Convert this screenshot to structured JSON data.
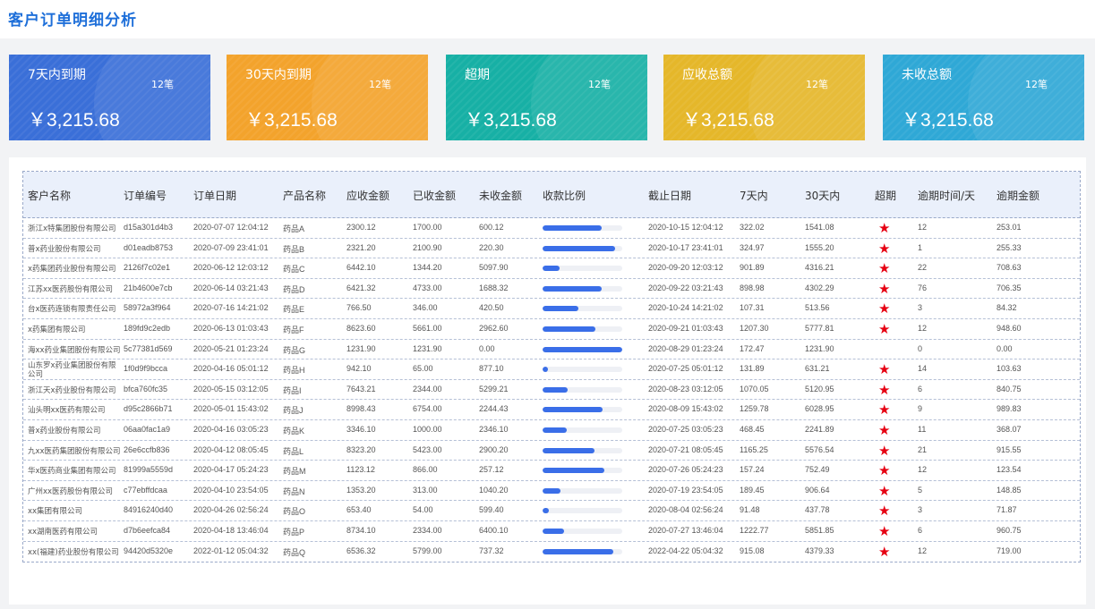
{
  "page_title": "客户订单明细分析",
  "cards": [
    {
      "title": "7天内到期",
      "count": "12笔",
      "amount": "￥3,215.68",
      "color": "#3a6fd8"
    },
    {
      "title": "30天内到期",
      "count": "12笔",
      "amount": "￥3,215.68",
      "color": "#f3a32c"
    },
    {
      "title": "超期",
      "count": "12笔",
      "amount": "￥3,215.68",
      "color": "#17b0a5"
    },
    {
      "title": "应收总额",
      "count": "12笔",
      "amount": "￥3,215.68",
      "color": "#e5b72a"
    },
    {
      "title": "未收总额",
      "count": "12笔",
      "amount": "￥3,215.68",
      "color": "#2fa8d6"
    }
  ],
  "table": {
    "headers": [
      "客户名称",
      "订单编号",
      "订单日期",
      "产品名称",
      "应收金额",
      "已收金额",
      "未收金额",
      "收款比例",
      "截止日期",
      "7天内",
      "30天内",
      "超期",
      "逾期时间/天",
      "逾期金额"
    ],
    "rows": [
      {
        "customer": "浙江x特集团股份有限公司",
        "order_no": "d15a301d4b3",
        "order_date": "2020-07-07 12:04:12",
        "product": "药品A",
        "receivable": "2300.12",
        "received": "1700.00",
        "unreceived": "600.12",
        "ratio": 0.74,
        "deadline": "2020-10-15 12:04:12",
        "d7": "322.02",
        "d30": "1541.08",
        "overdue": true,
        "overdue_days": "12",
        "overdue_amount": "253.01"
      },
      {
        "customer": "普x药业股份有限公司",
        "order_no": "d01eadb8753",
        "order_date": "2020-07-09 23:41:01",
        "product": "药品B",
        "receivable": "2321.20",
        "received": "2100.90",
        "unreceived": "220.30",
        "ratio": 0.91,
        "deadline": "2020-10-17 23:41:01",
        "d7": "324.97",
        "d30": "1555.20",
        "overdue": true,
        "overdue_days": "1",
        "overdue_amount": "255.33"
      },
      {
        "customer": "x药集团药业股份有限公司",
        "order_no": "2126f7c02e1",
        "order_date": "2020-06-12 12:03:12",
        "product": "药品C",
        "receivable": "6442.10",
        "received": "1344.20",
        "unreceived": "5097.90",
        "ratio": 0.21,
        "deadline": "2020-09-20 12:03:12",
        "d7": "901.89",
        "d30": "4316.21",
        "overdue": true,
        "overdue_days": "22",
        "overdue_amount": "708.63"
      },
      {
        "customer": "江苏xx医药股份有限公司",
        "order_no": "21b4600e7cb",
        "order_date": "2020-06-14 03:21:43",
        "product": "药品D",
        "receivable": "6421.32",
        "received": "4733.00",
        "unreceived": "1688.32",
        "ratio": 0.74,
        "deadline": "2020-09-22 03:21:43",
        "d7": "898.98",
        "d30": "4302.29",
        "overdue": true,
        "overdue_days": "76",
        "overdue_amount": "706.35"
      },
      {
        "customer": "台x医药连锁有限责任公司",
        "order_no": "58972a3f964",
        "order_date": "2020-07-16 14:21:02",
        "product": "药品E",
        "receivable": "766.50",
        "received": "346.00",
        "unreceived": "420.50",
        "ratio": 0.45,
        "deadline": "2020-10-24 14:21:02",
        "d7": "107.31",
        "d30": "513.56",
        "overdue": true,
        "overdue_days": "3",
        "overdue_amount": "84.32"
      },
      {
        "customer": "x药集团有限公司",
        "order_no": "189fd9c2edb",
        "order_date": "2020-06-13 01:03:43",
        "product": "药品F",
        "receivable": "8623.60",
        "received": "5661.00",
        "unreceived": "2962.60",
        "ratio": 0.66,
        "deadline": "2020-09-21 01:03:43",
        "d7": "1207.30",
        "d30": "5777.81",
        "overdue": true,
        "overdue_days": "12",
        "overdue_amount": "948.60"
      },
      {
        "customer": "海xx药业集团股份有限公司",
        "order_no": "5c77381d569",
        "order_date": "2020-05-21 01:23:24",
        "product": "药品G",
        "receivable": "1231.90",
        "received": "1231.90",
        "unreceived": "0.00",
        "ratio": 1.0,
        "deadline": "2020-08-29 01:23:24",
        "d7": "172.47",
        "d30": "1231.90",
        "overdue": false,
        "overdue_days": "0",
        "overdue_amount": "0.00"
      },
      {
        "customer": "山东罗x药业集团股份有限公司",
        "order_no": "1f0d9f9bcca",
        "order_date": "2020-04-16 05:01:12",
        "product": "药品H",
        "receivable": "942.10",
        "received": "65.00",
        "unreceived": "877.10",
        "ratio": 0.07,
        "deadline": "2020-07-25 05:01:12",
        "d7": "131.89",
        "d30": "631.21",
        "overdue": true,
        "overdue_days": "14",
        "overdue_amount": "103.63"
      },
      {
        "customer": "浙江天x药业股份有限公司",
        "order_no": "bfca760fc35",
        "order_date": "2020-05-15 03:12:05",
        "product": "药品I",
        "receivable": "7643.21",
        "received": "2344.00",
        "unreceived": "5299.21",
        "ratio": 0.31,
        "deadline": "2020-08-23 03:12:05",
        "d7": "1070.05",
        "d30": "5120.95",
        "overdue": true,
        "overdue_days": "6",
        "overdue_amount": "840.75"
      },
      {
        "customer": "汕头明xx医药有限公司",
        "order_no": "d95c2866b71",
        "order_date": "2020-05-01 15:43:02",
        "product": "药品J",
        "receivable": "8998.43",
        "received": "6754.00",
        "unreceived": "2244.43",
        "ratio": 0.75,
        "deadline": "2020-08-09 15:43:02",
        "d7": "1259.78",
        "d30": "6028.95",
        "overdue": true,
        "overdue_days": "9",
        "overdue_amount": "989.83"
      },
      {
        "customer": "普x药业股份有限公司",
        "order_no": "06aa0fac1a9",
        "order_date": "2020-04-16 03:05:23",
        "product": "药品K",
        "receivable": "3346.10",
        "received": "1000.00",
        "unreceived": "2346.10",
        "ratio": 0.3,
        "deadline": "2020-07-25 03:05:23",
        "d7": "468.45",
        "d30": "2241.89",
        "overdue": true,
        "overdue_days": "11",
        "overdue_amount": "368.07"
      },
      {
        "customer": "九xx医药集团股份有限公司",
        "order_no": "26e6ccfb836",
        "order_date": "2020-04-12 08:05:45",
        "product": "药品L",
        "receivable": "8323.20",
        "received": "5423.00",
        "unreceived": "2900.20",
        "ratio": 0.65,
        "deadline": "2020-07-21 08:05:45",
        "d7": "1165.25",
        "d30": "5576.54",
        "overdue": true,
        "overdue_days": "21",
        "overdue_amount": "915.55"
      },
      {
        "customer": "华x医药商业集团有限公司",
        "order_no": "81999a5559d",
        "order_date": "2020-04-17 05:24:23",
        "product": "药品M",
        "receivable": "1123.12",
        "received": "866.00",
        "unreceived": "257.12",
        "ratio": 0.77,
        "deadline": "2020-07-26 05:24:23",
        "d7": "157.24",
        "d30": "752.49",
        "overdue": true,
        "overdue_days": "12",
        "overdue_amount": "123.54"
      },
      {
        "customer": "广州xx医药股份有限公司",
        "order_no": "c77ebffdcaa",
        "order_date": "2020-04-10 23:54:05",
        "product": "药品N",
        "receivable": "1353.20",
        "received": "313.00",
        "unreceived": "1040.20",
        "ratio": 0.23,
        "deadline": "2020-07-19 23:54:05",
        "d7": "189.45",
        "d30": "906.64",
        "overdue": true,
        "overdue_days": "5",
        "overdue_amount": "148.85"
      },
      {
        "customer": "xx集团有限公司",
        "order_no": "84916240d40",
        "order_date": "2020-04-26 02:56:24",
        "product": "药品O",
        "receivable": "653.40",
        "received": "54.00",
        "unreceived": "599.40",
        "ratio": 0.08,
        "deadline": "2020-08-04 02:56:24",
        "d7": "91.48",
        "d30": "437.78",
        "overdue": true,
        "overdue_days": "3",
        "overdue_amount": "71.87"
      },
      {
        "customer": "xx湖南医药有限公司",
        "order_no": "d7b6eefca84",
        "order_date": "2020-04-18 13:46:04",
        "product": "药品P",
        "receivable": "8734.10",
        "received": "2334.00",
        "unreceived": "6400.10",
        "ratio": 0.27,
        "deadline": "2020-07-27 13:46:04",
        "d7": "1222.77",
        "d30": "5851.85",
        "overdue": true,
        "overdue_days": "6",
        "overdue_amount": "960.75"
      },
      {
        "customer": "xx(福建)药业股份有限公司",
        "order_no": "94420d5320e",
        "order_date": "2022-01-12 05:04:32",
        "product": "药品Q",
        "receivable": "6536.32",
        "received": "5799.00",
        "unreceived": "737.32",
        "ratio": 0.89,
        "deadline": "2022-04-22 05:04:32",
        "d7": "915.08",
        "d30": "4379.33",
        "overdue": true,
        "overdue_days": "12",
        "overdue_amount": "719.00"
      }
    ]
  }
}
